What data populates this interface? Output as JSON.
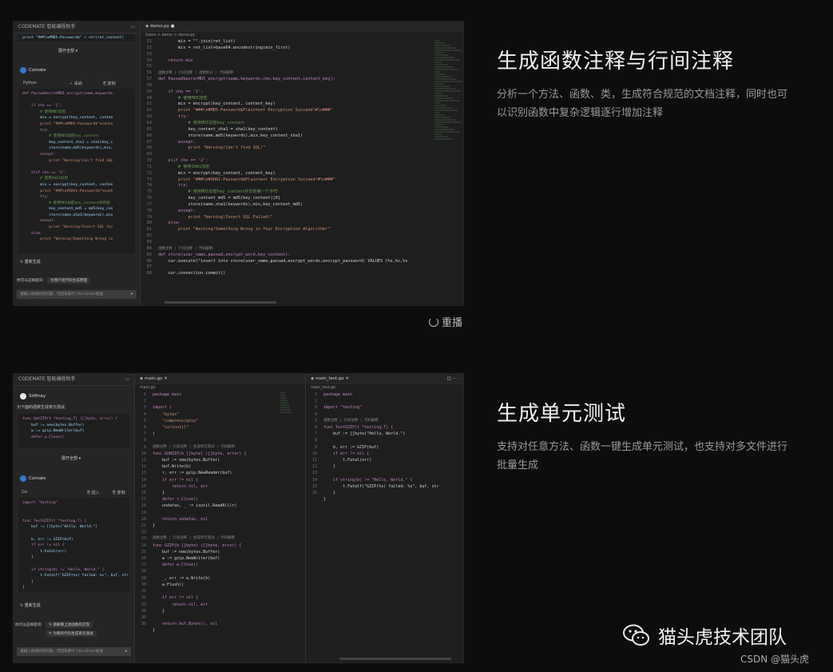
{
  "section1": {
    "title": "生成函数注释与行间注释",
    "description": "分析一个方法、函数、类，生成符合规范的文档注释，同时也可以识别函数中复杂逻辑逐行增加注释",
    "replay_label": "重播"
  },
  "section2": {
    "title": "生成单元测试",
    "description": "支持对任意方法、函数一键生成单元测试，也支持对多文件进行批量生成"
  },
  "brand": {
    "name": "猫头虎技术团队",
    "csdn": "CSDN @猫头虎"
  },
  "shot1": {
    "side_header": "CODEMATE 智能编程助手",
    "top_code": "print \"###\\n#MD5-Password$\" + str(ret_content)",
    "collapse_label": "展开全部 ▾",
    "codemate_label": "Comate",
    "lang_label": "Python",
    "adopt_label": "✓ 采纳",
    "copy_label": "⎘ 复制",
    "regen_label": "↻ 重新生成",
    "hint_label": "你可以这样提问:",
    "hint_button": "为我介绍代码生成原理",
    "input_placeholder": "请输入你想问的问题，可回车换行 Ctrl+Enter发送",
    "tab_label": "demo.py",
    "breadcrumb": "Users > demo > demo.py",
    "side_code": [
      "def PasswdSecretMD5_encrypt(name,keywords,",
      "",
      "    if cho == '1':",
      "        # 使用MD5加密",
      "        mix = encrypt(key_content, conten",
      "        print \"###\\n#MD5-Password$\"%conte",
      "        try:",
      "            # 使用MD5加密key_content",
      "            key_content_sha1 = sha1(key_c",
      "            store(name,md5(keywords),mix,",
      "        except:",
      "            print \"Warning!Can't find SQL",
      "",
      "    elif cho == '2':",
      "        # 使用SHA1加密",
      "        mix = encrypt(key_content, conten",
      "        print \"###\\n#SHA1-Password$\"%cont",
      "        try:",
      "            # 使用MD5加密key_content并存储",
      "            key_content_md5 = md5(key_con",
      "            store(name,sha1(keywords),mix",
      "        except:",
      "            print \"Warning!Insert SQL fai",
      "    else:",
      "        print \"Warning!Something Wrong in"
    ],
    "gutter": [
      "51",
      "52",
      "53",
      "54",
      "55",
      "56",
      "57",
      "58",
      "59",
      "60",
      "61",
      "62",
      "63",
      "64",
      "65",
      "66",
      "67",
      "68",
      "69",
      "70",
      "71",
      "72",
      "73",
      "74",
      "75",
      "76",
      "77",
      "78",
      "79",
      "80",
      "81",
      "82",
      "83",
      "84",
      "85",
      "86",
      "87",
      "88"
    ],
    "editor_code": [
      "        mix = \"\".join(ret_list)",
      "        mix = ret_list+base64.encodestring(mix_first)",
      "",
      "    return mix",
      "",
      "函数注释 | 行间注释 | 函数拆分 | 代码解释",
      "def PasswdSecretMD5_encrypt(name,keywords,cho,key_content,content_key):",
      "",
      "    if cho == '1':",
      "        # 使用MD5加密",
      "        mix = encrypt(key_content, content_key)",
      "        print \"###\\n#MD5-Password$Plaintext Encryption Succeed!#\\n###\"",
      "        try:",
      "            # 使用MD5加密key_content",
      "            key_content_sha1 = sha1(key_content)",
      "            store(name,md5(keywords),mix,key_content_sha1)",
      "        except:",
      "            print \"Warning!Can't find SQL!\"",
      "",
      "    elif cho == '2':",
      "        # 使用SHA1加密",
      "        mix = encrypt(key_content, content_key)",
      "        print \"###\\n#SHA1-Password$Plaintext Encryption Succeed!#\\n###\"",
      "        try:",
      "            # 使用MD5加密key_content并切除第一个字符",
      "            key_content_md5 = md5(key_content)[8]",
      "            store(name,sha1(keywords),mix,key_content_md5)",
      "        except:",
      "            print \"Warning!Insert SQL Failed!\"",
      "    else:",
      "        print \"Warning!Something Wrong in Your Encryption Algorithm!\"",
      "",
      "",
      "函数注释 | 行间注释 | 代码解释",
      "def store(user_name,passwd,encrypt_word,key_content):",
      "    cur.execute(\"insert into store(user_name,passwd,encrypt_words,encrypt_password) VALUES (%s,%s,%s",
      "",
      "    cur.connection.commit()"
    ]
  },
  "shot2": {
    "side_header": "CODEMATE 智能编程助手",
    "user_label": "Stiffney",
    "question": "为下面的函数生成单元测试:",
    "question_code": [
      "func GetZIP(t *testing.T) ([]byte, error) {",
      "    buf := new(bytes.Buffer)",
      "    w := gzip.NewWriter(buf)",
      "    defer w.Close()"
    ],
    "expand_label": "展开全部 ▾",
    "codemate_label": "Comate",
    "lang_label": "Go",
    "adopt_label": "⎘ 插入",
    "copy_label": "⎘ 复制",
    "answer_code": [
      "import \"testing\"",
      "",
      "",
      "func TestGZIP(t *testing.T) {",
      "    buf := []byte(\"Hello, World.\")",
      "",
      "    b, err := GZIP(buf)",
      "    if err != nil {",
      "        t.Fatal(err)",
      "    }",
      "",
      "    if string(b) != \"Hello, World.\" {",
      "        t.Fatalf(\"GZIP(%s) failed: %s\", buf, str",
      "    }",
      "}"
    ],
    "regen_label": "↻ 重新生成",
    "hint_label": "你可以这样提问:",
    "hint_button1": "✎ 请解释上述函数的实现",
    "hint_button2": "✎ 为我的代码生成单元测试",
    "input_placeholder": "请输入你想问的问题，可回车换行 Ctrl+Enter发送",
    "tab1_label": "main.go",
    "crumb1": "main.go",
    "tab2_label": "main_test.go",
    "crumb2": "main_test.go",
    "gutter1": [
      "1",
      "2",
      "3",
      "4",
      "5",
      "6",
      "7",
      "8",
      "9",
      "10",
      "11",
      "12",
      "13",
      "14",
      "15",
      "16",
      "17",
      "18",
      "19",
      "20",
      "21",
      "22",
      "23",
      "24",
      "25",
      "26",
      "27",
      "28",
      "29",
      "30",
      "31",
      "32",
      "33",
      "34",
      "35",
      "36"
    ],
    "code1": [
      "package main",
      "",
      "import (",
      "    \"bytes\"",
      "    \"compress/gzip\"",
      "    \"io/ioutil\"",
      ")",
      "",
      "函数注释 | 行间注释 | 生成单元测试 | 代码解释",
      "func GUNZIP(b []byte) ([]byte, error) {",
      "    buf := new(bytes.Buffer)",
      "    buf.Write(b)",
      "    r, err := gzip.NewReader(buf)",
      "    if err != nil {",
      "        return nil, err",
      "    }",
      "    defer r.Close()",
      "    undatas, _ := ioutil.ReadAll(r)",
      "",
      "    return undatas, nil",
      "}",
      "",
      "函数注释 | 行间注释 | 生成单元测试 | 代码解释",
      "func GZIP(b []byte) ([]byte, error) {",
      "    buf := new(bytes.Buffer)",
      "    w := gzip.NewWriter(buf)",
      "    defer w.Close()",
      "",
      "    _, err := w.Write(b)",
      "    w.Flush()",
      "",
      "    if err != nil {",
      "        return nil, err",
      "    }",
      "",
      "    return buf.Bytes(), nil",
      "}"
    ],
    "gutter2": [
      "1",
      "2",
      "3",
      "4",
      "5",
      "6",
      "7",
      "8",
      "9",
      "10",
      "11",
      "12",
      "13",
      "14",
      "15",
      "16"
    ],
    "code2": [
      "package main",
      "",
      "import \"testing\"",
      "",
      "函数注释 | 行间注释 | 代码解释",
      "func TestGZIP(t *testing.T) {",
      "    buf := []byte(\"Hello, World.\")",
      "",
      "    b, err := GZIP(buf)",
      "    if err != nil {",
      "        t.Fatal(err)",
      "    }",
      "",
      "    if string(b) != \"Hello, World.\" {",
      "        t.Fatalf(\"GZIP(%s) failed: %s\", buf, str",
      "    }",
      "}"
    ]
  }
}
